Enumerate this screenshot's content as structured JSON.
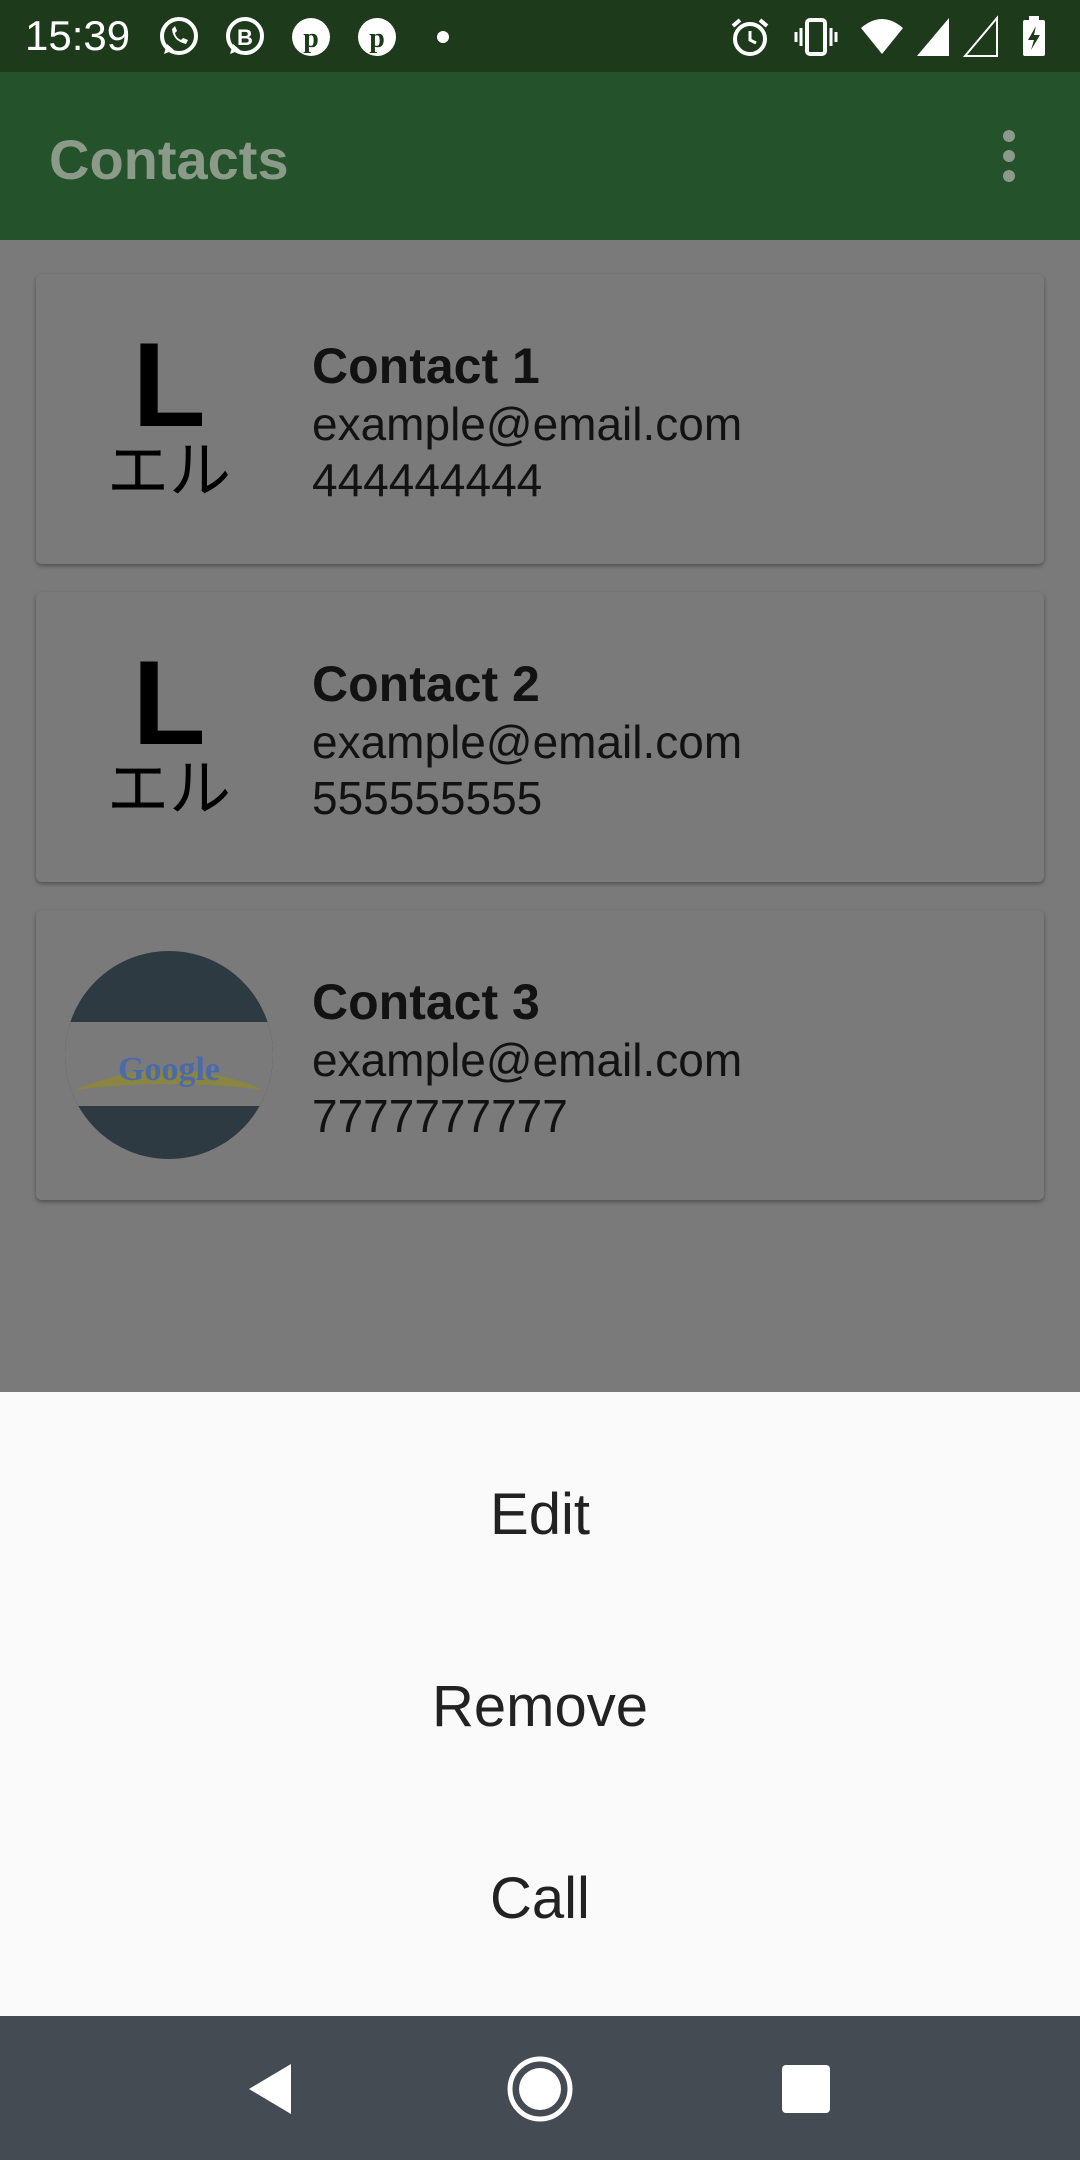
{
  "status_bar": {
    "time": "15:39",
    "left_icons": [
      "whatsapp-icon",
      "whatsapp-business-icon",
      "pinterest-icon",
      "pinterest-icon",
      "more-notifications-dot-icon"
    ],
    "right_icons": [
      "alarm-icon",
      "vibrate-icon",
      "wifi-icon",
      "signal-icon",
      "signal-empty-icon",
      "battery-charging-icon"
    ]
  },
  "app_bar": {
    "title": "Contacts",
    "menu_icon": "overflow-menu-icon"
  },
  "contacts": [
    {
      "name": "Contact 1",
      "email": "example@email.com",
      "phone": "444444444",
      "avatar": "letter-l-avatar"
    },
    {
      "name": "Contact 2",
      "email": "example@email.com",
      "phone": "555555555",
      "avatar": "letter-l-avatar"
    },
    {
      "name": "Contact 3",
      "email": "example@email.com",
      "phone": "7777777777",
      "avatar": "google-logo-avatar"
    }
  ],
  "avatar_text": {
    "letter": "L",
    "katakana": "エル",
    "google": "Google"
  },
  "bottom_sheet": {
    "items": [
      "Edit",
      "Remove",
      "Call"
    ]
  },
  "nav_bar": {
    "back_icon": "back-icon",
    "home_icon": "home-icon",
    "recents_icon": "recents-icon"
  },
  "colors": {
    "status_bar": "#1d3a1b",
    "app_bar": "#24522a",
    "scrim": "#7a7a7a",
    "sheet": "#fafafa",
    "nav_bar": "#454b52"
  }
}
